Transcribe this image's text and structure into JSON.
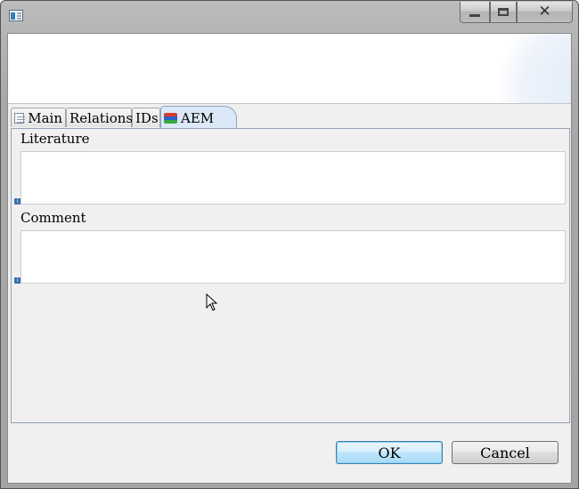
{
  "window": {
    "title": "",
    "controls": [
      "minimize",
      "maximize",
      "close"
    ]
  },
  "tabs": [
    {
      "label": "Main",
      "icon": "main-tab-icon",
      "active": false
    },
    {
      "label": "Relations",
      "icon": null,
      "active": false
    },
    {
      "label": "IDs",
      "icon": null,
      "active": false
    },
    {
      "label": "AEM",
      "icon": "aem-tab-icon",
      "active": true
    }
  ],
  "fields": {
    "literature": {
      "label": "Literature",
      "value": ""
    },
    "comment": {
      "label": "Comment",
      "value": ""
    }
  },
  "buttons": {
    "ok": "OK",
    "cancel": "Cancel"
  },
  "colors": {
    "active_tab": "#dbe8f7",
    "ok_button_border": "#3c7fb1",
    "panel_background": "#f0f0f0"
  }
}
